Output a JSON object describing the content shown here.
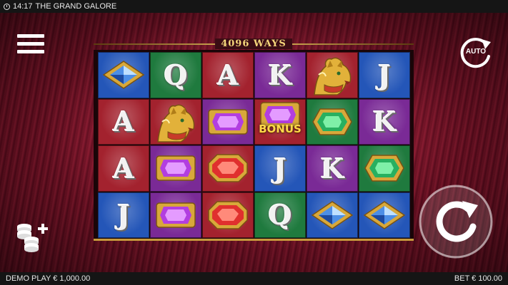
{
  "topbar": {
    "time": "14:17",
    "title": "THE GRAND GALORE"
  },
  "banner": {
    "ways_text": "4096 WAYS"
  },
  "auto_button": {
    "label": "AUTO"
  },
  "footer": {
    "mode_label": "DEMO PLAY",
    "balance": "€ 1,000.00",
    "bet_label": "BET",
    "bet_value": "€ 100.00"
  },
  "grid": {
    "rows": [
      [
        {
          "symbol": "blue-diamond",
          "bg": "blue"
        },
        {
          "symbol": "Q",
          "bg": "green"
        },
        {
          "symbol": "A",
          "bg": "red"
        },
        {
          "symbol": "K",
          "bg": "purple"
        },
        {
          "symbol": "panther",
          "bg": "red"
        },
        {
          "symbol": "J",
          "bg": "blue"
        }
      ],
      [
        {
          "symbol": "A",
          "bg": "red"
        },
        {
          "symbol": "panther",
          "bg": "red"
        },
        {
          "symbol": "purple-gem",
          "bg": "purple"
        },
        {
          "symbol": "bonus",
          "bg": "red",
          "text": "BONUS"
        },
        {
          "symbol": "green-gem",
          "bg": "green"
        },
        {
          "symbol": "K",
          "bg": "purple"
        }
      ],
      [
        {
          "symbol": "A",
          "bg": "red"
        },
        {
          "symbol": "purple-gem",
          "bg": "purple"
        },
        {
          "symbol": "red-gem",
          "bg": "red"
        },
        {
          "symbol": "J",
          "bg": "blue"
        },
        {
          "symbol": "K",
          "bg": "purple"
        },
        {
          "symbol": "green-gem",
          "bg": "green"
        }
      ],
      [
        {
          "symbol": "J",
          "bg": "blue"
        },
        {
          "symbol": "purple-gem",
          "bg": "purple"
        },
        {
          "symbol": "red-gem",
          "bg": "red"
        },
        {
          "symbol": "Q",
          "bg": "green"
        },
        {
          "symbol": "blue-diamond",
          "bg": "blue"
        },
        {
          "symbol": "blue-diamond",
          "bg": "blue"
        }
      ]
    ]
  },
  "colors": {
    "gold": "#e2b650",
    "bg_red": "#a3222e",
    "bg_blue": "#2456b8",
    "bg_green": "#1f7a3e",
    "bg_purple": "#7a2a96"
  },
  "icons": {
    "menu": "hamburger-menu-icon",
    "auto": "auto-spin-icon",
    "coins": "coin-stack-plus-icon",
    "spin": "spin-arrow-icon",
    "clock": "clock-icon"
  }
}
